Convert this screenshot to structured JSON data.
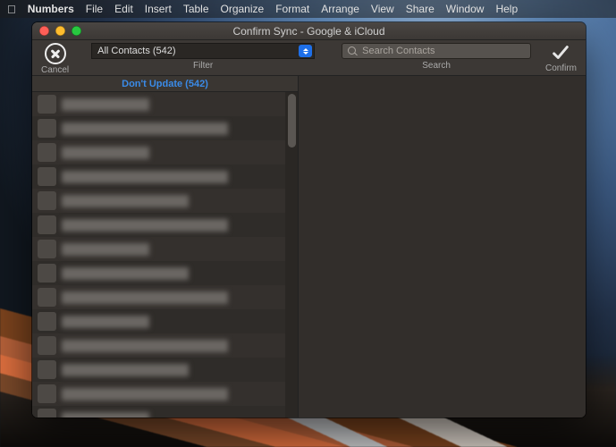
{
  "menubar": {
    "app": "Numbers",
    "items": [
      "File",
      "Edit",
      "Insert",
      "Table",
      "Organize",
      "Format",
      "Arrange",
      "View",
      "Share",
      "Window",
      "Help"
    ]
  },
  "window": {
    "title": "Confirm Sync - Google & iCloud"
  },
  "toolbar": {
    "cancel_label": "Cancel",
    "filter_label": "Filter",
    "filter_value": "All Contacts (542)",
    "search_label": "Search",
    "search_placeholder": "Search Contacts",
    "confirm_label": "Confirm"
  },
  "list": {
    "section_header": "Don't Update (542)",
    "rows": [
      {
        "w": "w1"
      },
      {
        "w": "w2"
      },
      {
        "w": "w1"
      },
      {
        "w": "w2"
      },
      {
        "w": ""
      },
      {
        "w": "w2"
      },
      {
        "w": "w1"
      },
      {
        "w": ""
      },
      {
        "w": "w2"
      },
      {
        "w": "w1"
      },
      {
        "w": "w2"
      },
      {
        "w": ""
      },
      {
        "w": "w2"
      },
      {
        "w": "w1"
      }
    ]
  }
}
